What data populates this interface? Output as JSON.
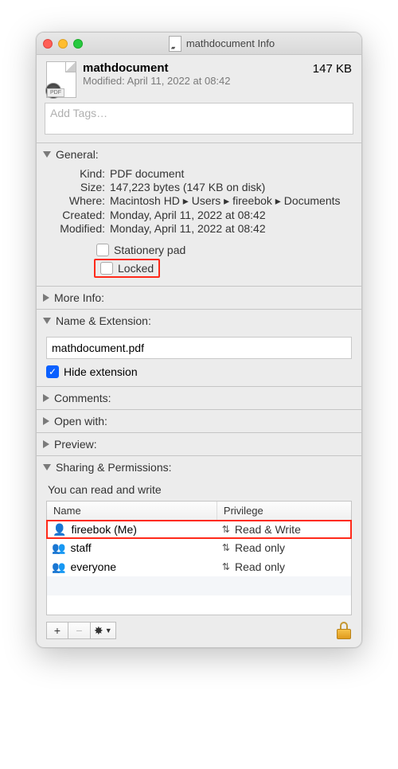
{
  "window": {
    "title": "mathdocument Info"
  },
  "header": {
    "filename": "mathdocument",
    "modified_label": "Modified: April 11, 2022 at 08:42",
    "size": "147 KB",
    "pdf_label": "PDF"
  },
  "tags": {
    "placeholder": "Add Tags…"
  },
  "sections": {
    "general": "General:",
    "more_info": "More Info:",
    "name_ext": "Name & Extension:",
    "comments": "Comments:",
    "open_with": "Open with:",
    "preview": "Preview:",
    "sharing": "Sharing & Permissions:"
  },
  "general": {
    "kind_k": "Kind:",
    "kind_v": "PDF document",
    "size_k": "Size:",
    "size_v": "147,223 bytes (147 KB on disk)",
    "where_k": "Where:",
    "where_v": "Macintosh HD ▸ Users ▸ fireebok ▸ Documents",
    "created_k": "Created:",
    "created_v": "Monday, April 11, 2022 at 08:42",
    "modified_k": "Modified:",
    "modified_v": "Monday, April 11, 2022 at 08:42",
    "stationery_label": "Stationery pad",
    "locked_label": "Locked"
  },
  "name_ext": {
    "filename": "mathdocument.pdf",
    "hide_label": "Hide extension"
  },
  "permissions": {
    "message": "You can read and write",
    "name_header": "Name",
    "priv_header": "Privilege",
    "rows": [
      {
        "name": "fireebok (Me)",
        "priv": "Read & Write"
      },
      {
        "name": "staff",
        "priv": "Read only"
      },
      {
        "name": "everyone",
        "priv": "Read only"
      }
    ]
  },
  "toolbar": {
    "plus": "+",
    "minus": "−",
    "gear": "✱▾"
  }
}
